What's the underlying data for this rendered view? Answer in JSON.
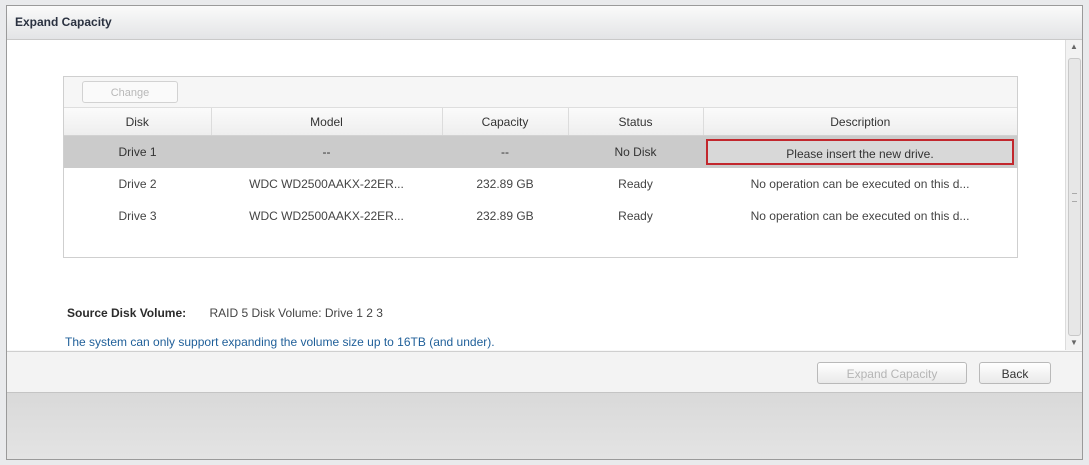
{
  "window": {
    "title": "Expand Capacity"
  },
  "toolbar": {
    "change_label": "Change"
  },
  "table": {
    "columns": [
      "Disk",
      "Model",
      "Capacity",
      "Status",
      "Description"
    ],
    "rows": [
      [
        "Drive 1",
        "--",
        "--",
        "No Disk",
        "Please insert the new drive."
      ],
      [
        "Drive 2",
        "WDC WD2500AAKX-22ER...",
        "232.89 GB",
        "Ready",
        "No operation can be executed on this d..."
      ],
      [
        "Drive 3",
        "WDC WD2500AAKX-22ER...",
        "232.89 GB",
        "Ready",
        "No operation can be executed on this d..."
      ]
    ]
  },
  "source": {
    "label": "Source Disk Volume:",
    "value": "RAID 5 Disk Volume: Drive 1 2 3"
  },
  "note": "The system can only support expanding the volume size up to 16TB (and under).",
  "buttons": {
    "expand": "Expand Capacity",
    "back": "Back"
  },
  "colors": {
    "highlight_border": "#c2272d",
    "note_text": "#1f5f99",
    "selected_row": "#cbcbcb"
  },
  "icons": {
    "scroll_up": "arrow-up-icon",
    "scroll_down": "arrow-down-icon"
  }
}
